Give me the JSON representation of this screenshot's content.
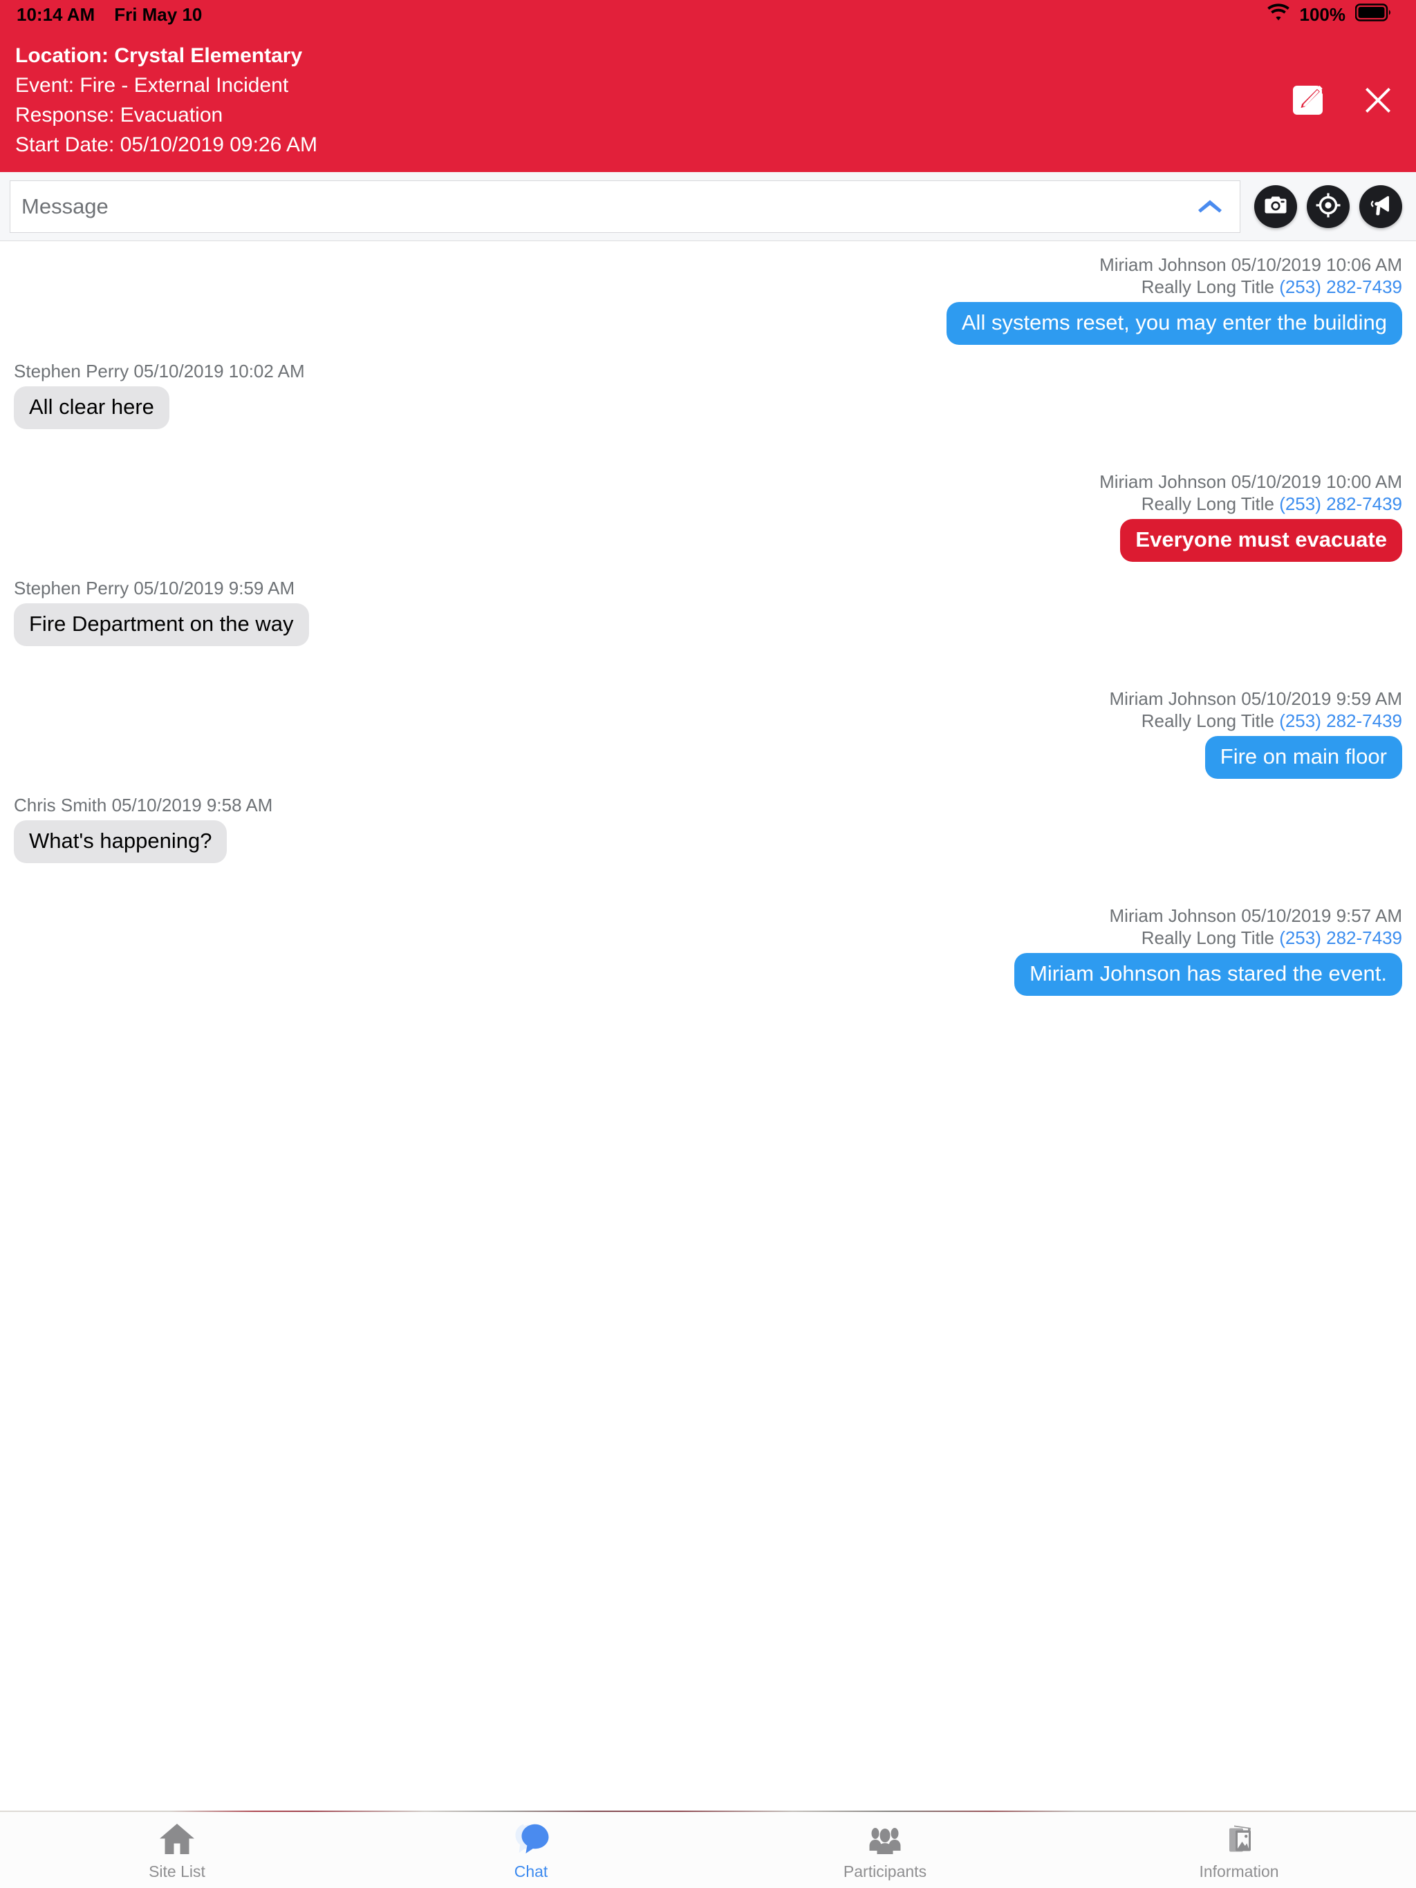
{
  "status_bar": {
    "time": "10:14 AM",
    "date": "Fri May 10",
    "battery_percent": "100%",
    "wifi_icon": "wifi-icon",
    "battery_icon": "battery-full-icon",
    "text_color": "#000000",
    "background": "#E2203A"
  },
  "header": {
    "background": "#E2203A",
    "location_line": "Location: Crystal Elementary",
    "event_line": "Event: Fire - External Incident",
    "response_line": "Response: Evacuation",
    "start_date_line": "Start Date: 05/10/2019 09:26 AM",
    "edit_icon": "compose-edit-icon",
    "close_icon": "close-icon"
  },
  "composer": {
    "placeholder": "Message",
    "value": "",
    "expand_icon": "chevron-up-icon",
    "expand_icon_color": "#4A8BEF",
    "actions": [
      {
        "name": "camera-button",
        "icon": "camera-icon"
      },
      {
        "name": "location-button",
        "icon": "target-location-icon"
      },
      {
        "name": "broadcast-button",
        "icon": "megaphone-icon"
      }
    ]
  },
  "colors": {
    "accent_red": "#DC1B31",
    "accent_blue": "#2E9BF0",
    "incoming_gray": "#E4E4E6",
    "link_blue": "#3B8DEF",
    "meta_gray": "#6E7276"
  },
  "thread": {
    "messages": [
      {
        "direction": "out",
        "style": "blue",
        "sender_line": "Miriam Johnson 05/10/2019 10:06 AM",
        "title": "Really Long Title",
        "phone": "(253) 282-7439",
        "text": "All systems reset, you may enter the building"
      },
      {
        "direction": "in",
        "style": "gray",
        "sender_line": "Stephen Perry 05/10/2019 10:02 AM",
        "title": "",
        "phone": "",
        "text": "All clear here"
      },
      {
        "direction": "out",
        "style": "red",
        "sender_line": "Miriam Johnson 05/10/2019 10:00 AM",
        "title": "Really Long Title",
        "phone": "(253) 282-7439",
        "text": "Everyone must evacuate"
      },
      {
        "direction": "in",
        "style": "gray",
        "sender_line": "Stephen Perry 05/10/2019 9:59 AM",
        "title": "",
        "phone": "",
        "text": "Fire Department on the way"
      },
      {
        "direction": "out",
        "style": "blue",
        "sender_line": "Miriam Johnson 05/10/2019 9:59 AM",
        "title": "Really Long Title",
        "phone": "(253) 282-7439",
        "text": "Fire on main floor"
      },
      {
        "direction": "in",
        "style": "gray",
        "sender_line": "Chris Smith 05/10/2019 9:58 AM",
        "title": "",
        "phone": "",
        "text": "What's happening?"
      },
      {
        "direction": "out",
        "style": "blue",
        "sender_line": "Miriam Johnson 05/10/2019 9:57 AM",
        "title": "Really Long Title",
        "phone": "(253) 282-7439",
        "text": "Miriam Johnson has stared the event."
      }
    ]
  },
  "tabbar": {
    "active": "Chat",
    "tabs": [
      {
        "label": "Site List",
        "icon": "home-icon",
        "active": false
      },
      {
        "label": "Chat",
        "icon": "chat-bubble-icon",
        "active": true
      },
      {
        "label": "Participants",
        "icon": "people-icon",
        "active": false
      },
      {
        "label": "Information",
        "icon": "photos-gallery-icon",
        "active": false
      }
    ]
  }
}
